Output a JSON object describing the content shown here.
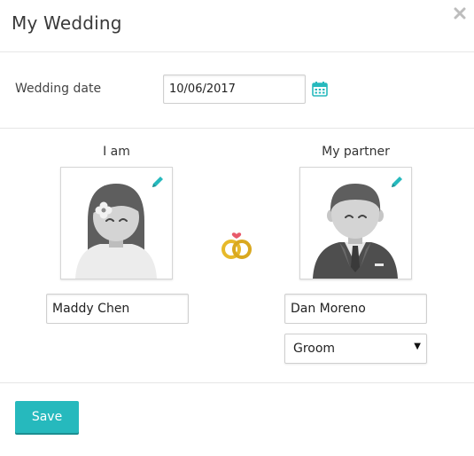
{
  "modal": {
    "title": "My Wedding"
  },
  "wedding_date": {
    "label": "Wedding date",
    "value": "10/06/2017"
  },
  "me": {
    "heading": "I am",
    "name": "Maddy Chen"
  },
  "partner": {
    "heading": "My partner",
    "name": "Dan Moreno",
    "role_options": [
      "Groom"
    ],
    "role_selected": "Groom"
  },
  "actions": {
    "save_label": "Save"
  },
  "colors": {
    "accent": "#26b9bd",
    "ring_gold": "#e7b92a",
    "heart": "#e85a6a"
  },
  "icons": [
    "close-icon",
    "calendar-icon",
    "pencil-icon",
    "wedding-rings-icon"
  ]
}
